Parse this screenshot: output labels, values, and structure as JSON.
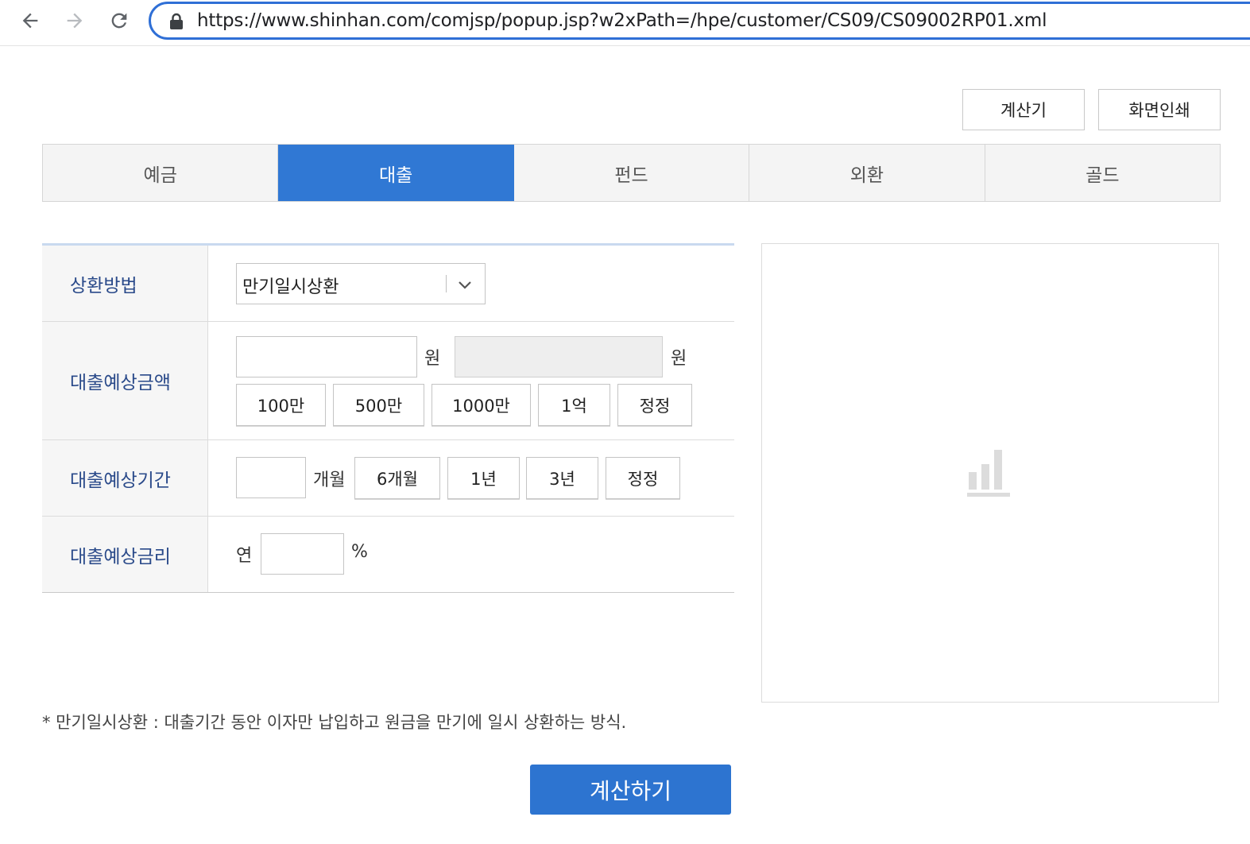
{
  "browser": {
    "url": "https://www.shinhan.com/comjsp/popup.jsp?w2xPath=/hpe/customer/CS09/CS09002RP01.xml",
    "back_icon": "arrow-left-icon",
    "forward_icon": "arrow-right-icon",
    "reload_icon": "reload-icon",
    "lock_icon": "lock-icon"
  },
  "toolbar": {
    "calculator_label": "계산기",
    "print_label": "화면인쇄"
  },
  "tabs": [
    {
      "label": "예금",
      "active": false
    },
    {
      "label": "대출",
      "active": true
    },
    {
      "label": "펀드",
      "active": false
    },
    {
      "label": "외환",
      "active": false
    },
    {
      "label": "골드",
      "active": false
    }
  ],
  "form": {
    "repayment": {
      "label": "상환방법",
      "selected": "만기일시상환"
    },
    "amount": {
      "label": "대출예상금액",
      "input_value": "",
      "unit": "원",
      "display_value": "",
      "display_unit": "원",
      "quick_buttons": [
        "100만",
        "500만",
        "1000만",
        "1억",
        "정정"
      ]
    },
    "period": {
      "label": "대출예상기간",
      "input_value": "",
      "unit": "개월",
      "quick_buttons": [
        "6개월",
        "1년",
        "3년",
        "정정"
      ]
    },
    "rate": {
      "label": "대출예상금리",
      "prefix": "연",
      "input_value": "",
      "unit": "%"
    }
  },
  "chart_placeholder_icon": "bar-chart-icon",
  "note": "* 만기일시상환 : 대출기간 동안 이자만 납입하고 원금을 만기에 일시 상환하는 방식.",
  "calculate_label": "계산하기",
  "colors": {
    "accent": "#3078d4",
    "button_primary": "#2d74d0",
    "omnibox_border": "#2f6fd6",
    "label_text": "#2a4a8a"
  }
}
